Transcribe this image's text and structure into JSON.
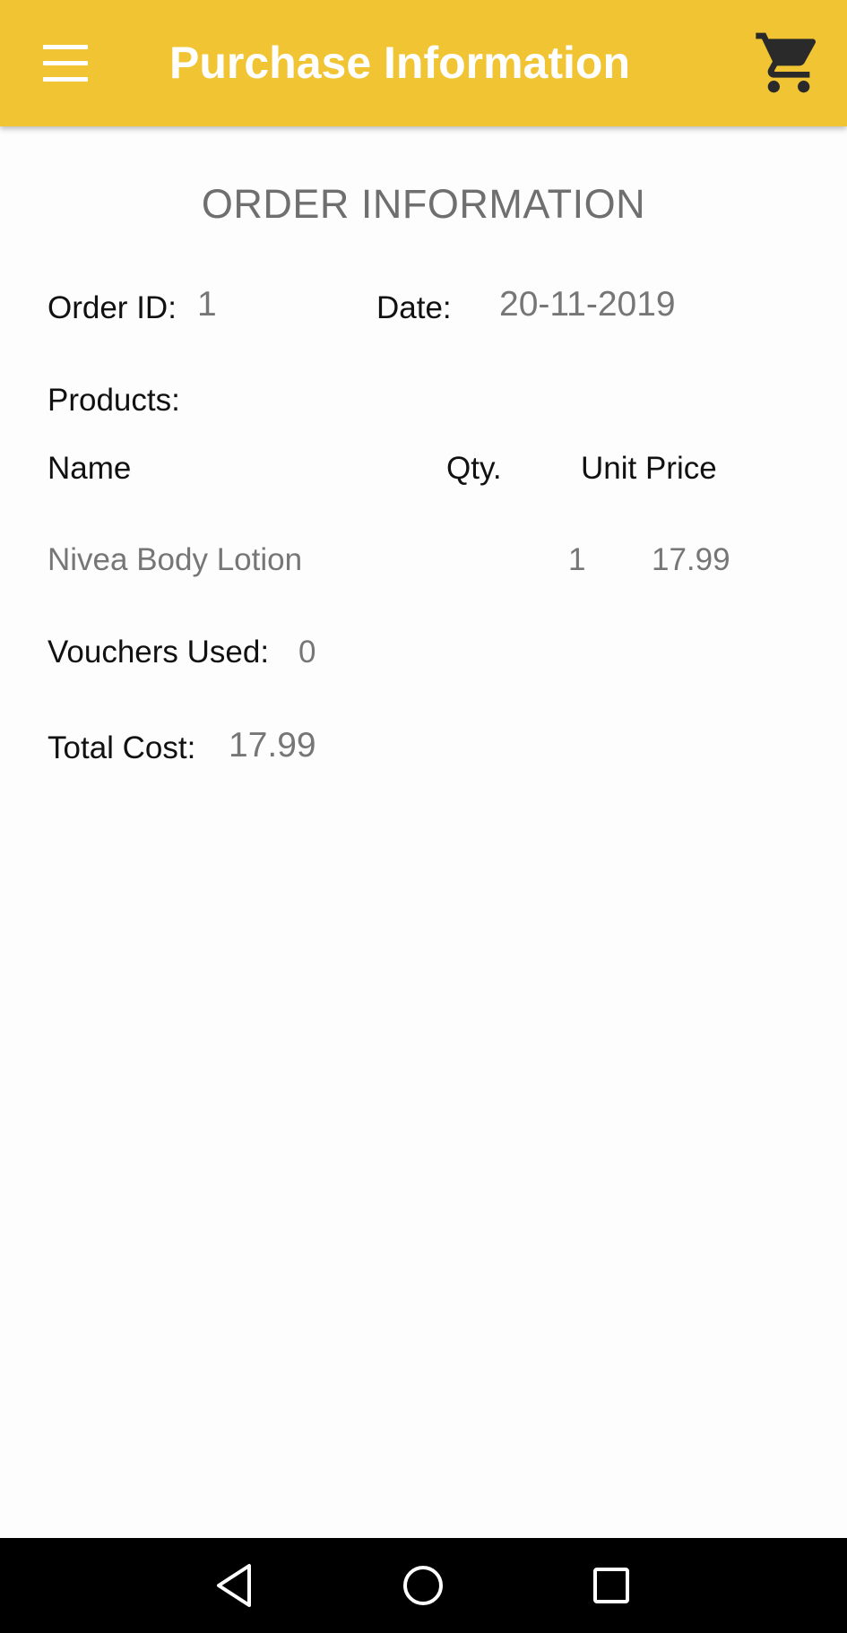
{
  "app_bar": {
    "title": "Purchase Information",
    "menu_icon": "menu-icon",
    "cart_icon": "shopping-cart-icon",
    "background_color": "#f1c433"
  },
  "order": {
    "section_title": "ORDER INFORMATION",
    "order_id_label": "Order ID:",
    "order_id_value": "1",
    "date_label": "Date:",
    "date_value": "20-11-2019",
    "products_label": "Products:",
    "columns": {
      "name": "Name",
      "qty": "Qty.",
      "unit_price": "Unit Price"
    },
    "products": [
      {
        "name": "Nivea Body Lotion",
        "qty": "1",
        "unit_price": "17.99"
      }
    ],
    "vouchers_label": "Vouchers Used:",
    "vouchers_value": "0",
    "total_label": "Total Cost:",
    "total_value": "17.99"
  },
  "nav_bar": {
    "back_icon": "back-triangle-icon",
    "home_icon": "home-circle-icon",
    "recents_icon": "recents-square-icon"
  }
}
